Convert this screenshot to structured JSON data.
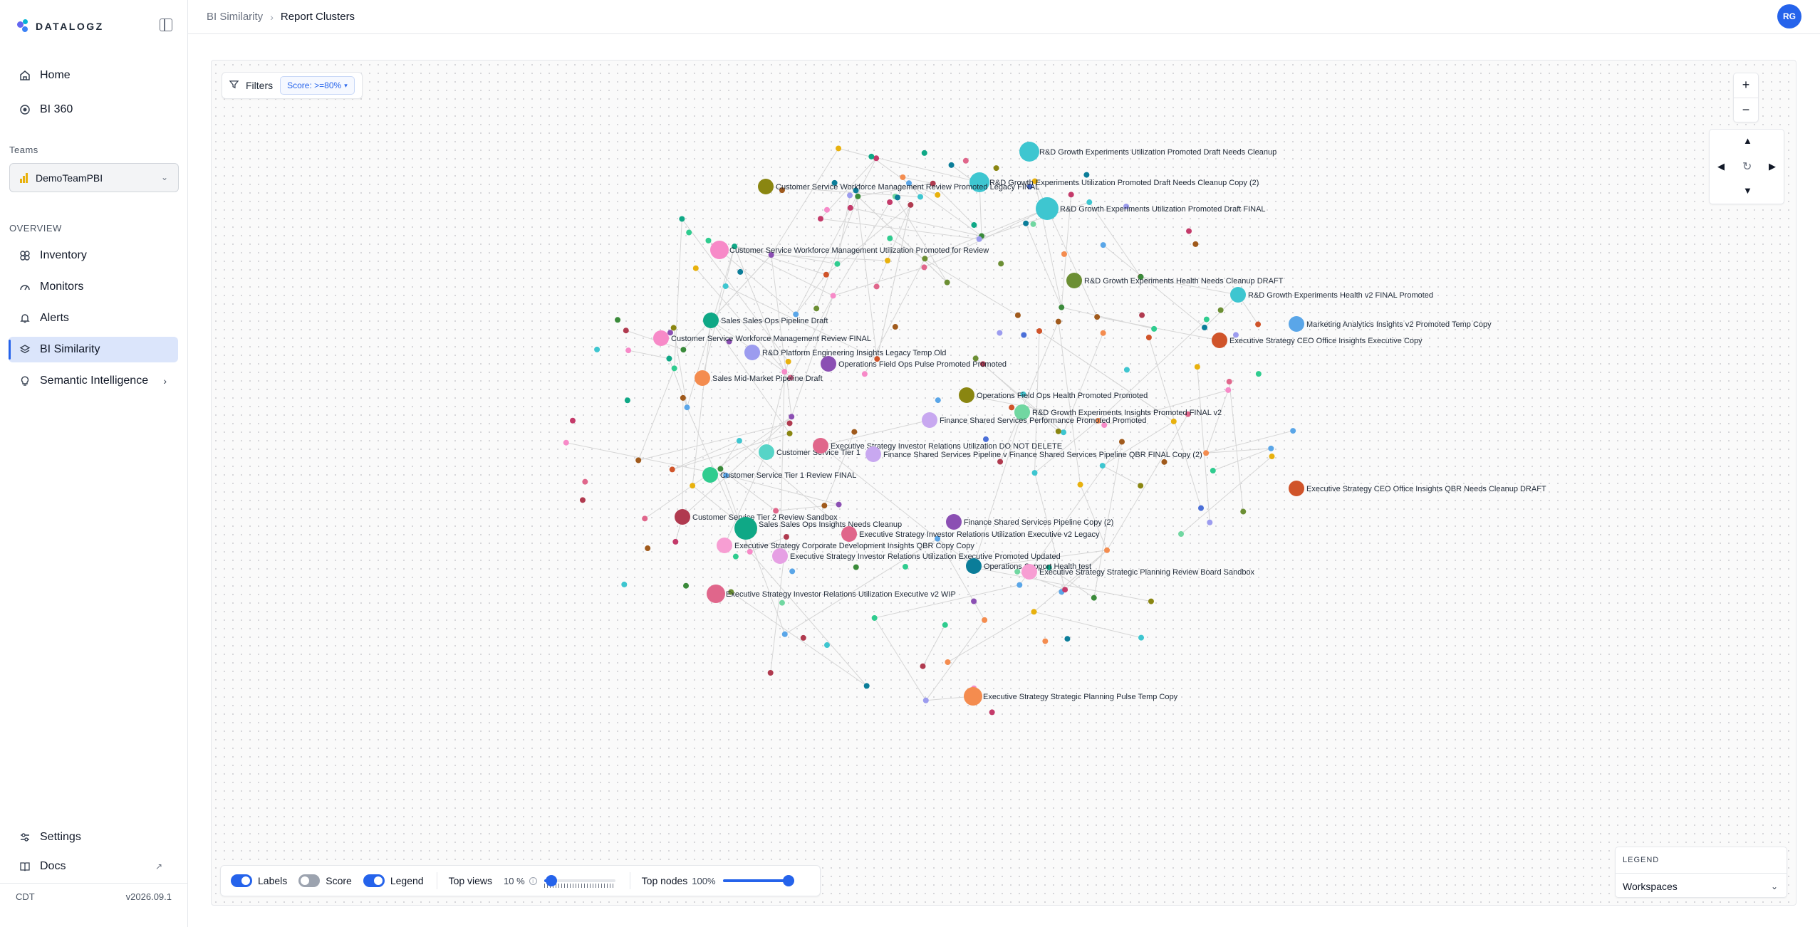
{
  "app": {
    "brand": "DATALOGZ",
    "user_initials": "RG",
    "timezone": "CDT",
    "version": "v2026.09.1"
  },
  "sidebar": {
    "top_items": [
      {
        "label": "Home",
        "icon": "home-icon"
      },
      {
        "label": "BI 360",
        "icon": "target-icon"
      }
    ],
    "teams_label": "Teams",
    "team_selected": "DemoTeamPBI",
    "overview_label": "OVERVIEW",
    "overview_items": [
      {
        "label": "Inventory",
        "icon": "inventory-icon"
      },
      {
        "label": "Monitors",
        "icon": "gauge-icon"
      },
      {
        "label": "Alerts",
        "icon": "bell-icon"
      },
      {
        "label": "BI Similarity",
        "icon": "layers-icon",
        "active": true
      },
      {
        "label": "Semantic Intelligence",
        "icon": "lightbulb-icon"
      }
    ],
    "bottom_items": [
      {
        "label": "Settings",
        "icon": "sliders-icon"
      },
      {
        "label": "Docs",
        "icon": "book-icon"
      }
    ]
  },
  "header": {
    "breadcrumb_parent": "BI Similarity",
    "breadcrumb_current": "Report Clusters"
  },
  "toolbar": {
    "filters_label": "Filters",
    "score_chip": "Score: >=80%"
  },
  "controls": {
    "zoom_in": "+",
    "zoom_out": "−",
    "pan_up": "▲",
    "pan_down": "▼",
    "pan_left": "◀",
    "pan_right": "▶",
    "reset": "↻"
  },
  "bottom_bar": {
    "labels_toggle": {
      "label": "Labels",
      "on": true
    },
    "score_toggle": {
      "label": "Score",
      "on": false
    },
    "legend_toggle": {
      "label": "Legend",
      "on": true
    },
    "top_views_label": "Top views",
    "top_views_value": "10 %",
    "top_views_fraction": 0.1,
    "top_nodes_label": "Top nodes",
    "top_nodes_value": "100%",
    "top_nodes_fraction": 1.0
  },
  "legend": {
    "title": "LEGEND",
    "selected": "Workspaces"
  },
  "graph": {
    "labeled_nodes": [
      {
        "label": "R&D Growth Experiments Utilization Promoted Draft Needs Cleanup",
        "color": "#3ec6d0"
      },
      {
        "label": "R&D Growth Experiments Utilization Promoted Draft Needs Cleanup Copy (2)",
        "color": "#3ec6d0"
      },
      {
        "label": "Customer Service Workforce Management Review Promoted Legacy FINAL",
        "color": "#8a8611"
      },
      {
        "label": "R&D Growth Experiments Utilization Promoted Draft FINAL",
        "color": "#3ec6d0"
      },
      {
        "label": "Customer Service Workforce Management Utilization Promoted for Review",
        "color": "#f78ac8"
      },
      {
        "label": "R&D Growth Experiments Health Needs Cleanup DRAFT",
        "color": "#6c8f34"
      },
      {
        "label": "R&D Growth Experiments Health v2 FINAL Promoted",
        "color": "#3ec6d0"
      },
      {
        "label": "Marketing Analytics Insights v2 Promoted Temp Copy",
        "color": "#5aa6e8"
      },
      {
        "label": "Sales Sales Ops Pipeline Draft",
        "color": "#0fa886"
      },
      {
        "label": "Customer Service Workforce Management Review FINAL",
        "color": "#f78ac8"
      },
      {
        "label": "Executive Strategy CEO Office Insights Executive Copy",
        "color": "#d0542a"
      },
      {
        "label": "R&D Platform Engineering Insights Legacy Temp Old",
        "color": "#9c9cef"
      },
      {
        "label": "Operations Field Ops Pulse Promoted Promoted",
        "color": "#8b4fb3"
      },
      {
        "label": "Sales Mid-Market Pipeline Draft",
        "color": "#f48c4f"
      },
      {
        "label": "Operations Field Ops Health Promoted Promoted",
        "color": "#8a8611"
      },
      {
        "label": "R&D Growth Experiments Insights Promoted FINAL v2",
        "color": "#71d7a1"
      },
      {
        "label": "Finance Shared Services Performance Promoted Promoted",
        "color": "#c8a8f0"
      },
      {
        "label": "Customer Service Tier 1",
        "color": "#56d4c7"
      },
      {
        "label": "Executive Strategy Investor Relations Utilization DO NOT DELETE",
        "color": "#e0668b"
      },
      {
        "label": "Finance Shared Services Pipeline v Finance Shared Services Pipeline QBR FINAL Copy (2)",
        "color": "#c8a8f0"
      },
      {
        "label": "Customer Service Tier 1 Review FINAL",
        "color": "#2fcc8f"
      },
      {
        "label": "Executive Strategy CEO Office Insights QBR Needs Cleanup DRAFT",
        "color": "#d0542a"
      },
      {
        "label": "Customer Service Tier 2 Review Sandbox",
        "color": "#b03a4f"
      },
      {
        "label": "Finance Shared Services Pipeline Copy (2)",
        "color": "#8b4fb3"
      },
      {
        "label": "Sales Sales Ops Insights Needs Cleanup",
        "color": "#0fa886"
      },
      {
        "label": "Executive Strategy Investor Relations Utilization Executive v2 Legacy",
        "color": "#e0668b"
      },
      {
        "label": "Executive Strategy Corporate Development Insights QBR Copy Copy",
        "color": "#f79ed3"
      },
      {
        "label": "Executive Strategy Investor Relations Utilization Executive Promoted Updated",
        "color": "#e6a0e4"
      },
      {
        "label": "Operations Support Health test",
        "color": "#0b7d99"
      },
      {
        "label": "Executive Strategy Strategic Planning Review Board Sandbox",
        "color": "#f79ed3"
      },
      {
        "label": "Executive Strategy Investor Relations Utilization Executive v2 WIP",
        "color": "#e0668b"
      },
      {
        "label": "Executive Strategy Strategic Planning Pulse Temp Copy",
        "color": "#f48c4f"
      }
    ],
    "dot_palette": [
      "#3ec6d0",
      "#8a8611",
      "#f78ac8",
      "#0fa886",
      "#5aa6e8",
      "#d0542a",
      "#9c9cef",
      "#8b4fb3",
      "#f48c4f",
      "#71d7a1",
      "#e0668b",
      "#2fcc8f",
      "#b03a4f",
      "#0b7d99",
      "#6c8f34",
      "#e8b10d",
      "#4b6fd8",
      "#3a8a3a",
      "#a05a1c",
      "#c43a6a"
    ]
  }
}
